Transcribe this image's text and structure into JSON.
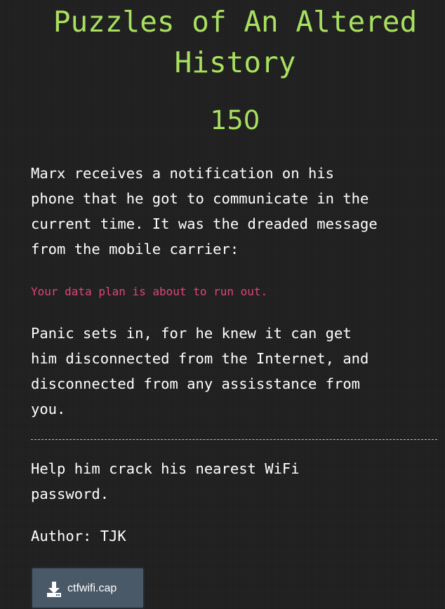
{
  "challenge": {
    "title": "Puzzles of An Altered History",
    "points": "150",
    "paragraph_1": "Marx receives a notification on his\nphone that he got to communicate in the\ncurrent time. It was the dreaded message\nfrom the mobile carrier:",
    "quote": "Your data plan is about to run out.",
    "paragraph_2": "Panic sets in, for he knew it can get\nhim disconnected from the Internet, and\ndisconnected from any assisstance from\nyou.",
    "paragraph_3": "Help him crack his nearest WiFi\npassword.",
    "author": "Author: TJK",
    "file": {
      "name": "ctfwifi.cap",
      "icon": "download-icon"
    }
  },
  "colors": {
    "background": "#1e1e1e",
    "accent_green": "#a8e05f",
    "quote_pink": "#e0457b",
    "button_bg": "#4a5968"
  }
}
